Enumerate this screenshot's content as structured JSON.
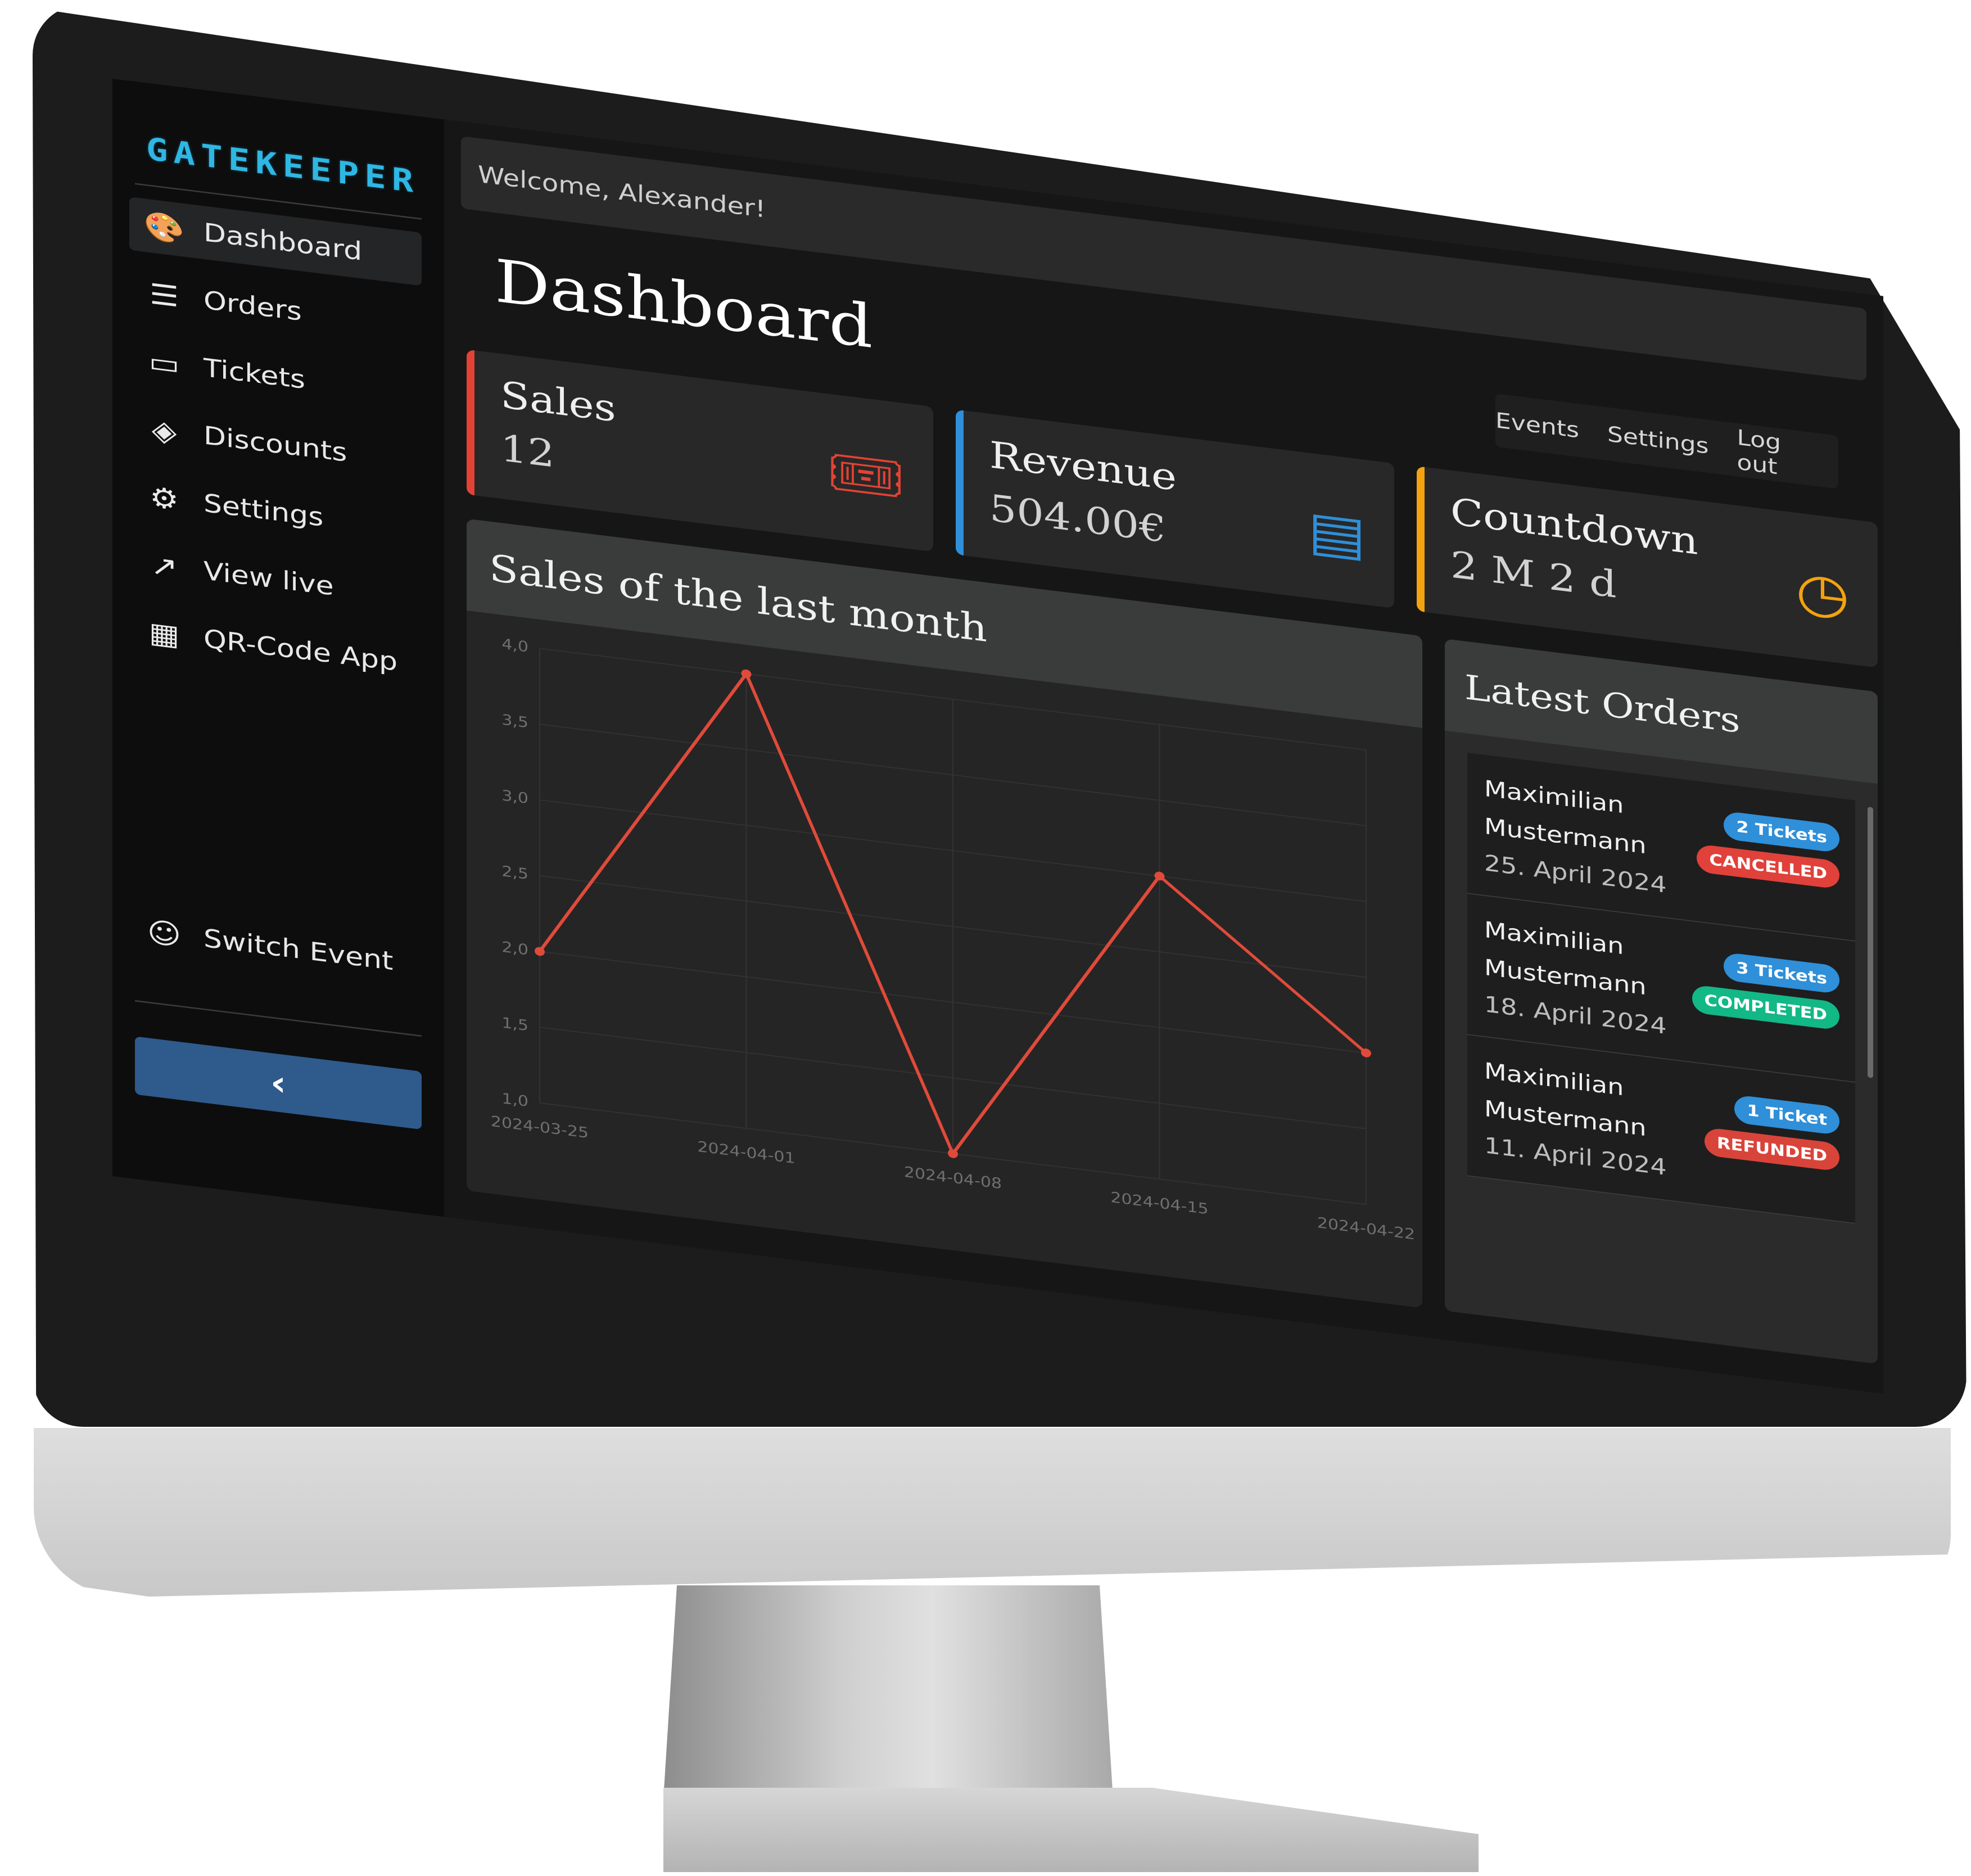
{
  "app": {
    "logo_text": "GATEKEEPER"
  },
  "sidebar": {
    "items": [
      {
        "label": "Dashboard",
        "icon": "palette-icon",
        "active": true
      },
      {
        "label": "Orders",
        "icon": "list-icon"
      },
      {
        "label": "Tickets",
        "icon": "ticket-icon"
      },
      {
        "label": "Discounts",
        "icon": "tags-icon"
      },
      {
        "label": "Settings",
        "icon": "gears-icon"
      },
      {
        "label": "View live",
        "icon": "external-link-icon"
      },
      {
        "label": "QR-Code App",
        "icon": "qr-code-icon"
      }
    ],
    "switch_event": {
      "label": "Switch Event",
      "icon": "masks-icon"
    },
    "collapse_icon": "chevron-left-icon"
  },
  "header": {
    "welcome": "Welcome, Alexander!",
    "page_title": "Dashboard",
    "links": [
      "Events",
      "Settings",
      "Log out"
    ]
  },
  "stats": [
    {
      "label": "Sales",
      "value": "12",
      "icon": "ticket-icon",
      "color": "#e34234"
    },
    {
      "label": "Revenue",
      "value": "504.00€",
      "icon": "cash-register-icon",
      "color": "#2f8fd8"
    },
    {
      "label": "Countdown",
      "value": "2 M 2 d",
      "icon": "clock-icon",
      "color": "#f2a30f"
    }
  ],
  "chart": {
    "title": "Sales of the last month"
  },
  "chart_data": {
    "type": "line",
    "title": "Sales of the last month",
    "x": [
      "2024-03-25",
      "2024-04-01",
      "2024-04-08",
      "2024-04-15",
      "2024-04-22"
    ],
    "y_ticks": [
      "1,0",
      "1,5",
      "2,0",
      "2,5",
      "3,0",
      "3,5",
      "4,0"
    ],
    "series": [
      {
        "x": [
          "2024-03-25",
          "2024-04-01",
          "2024-04-08",
          "2024-04-15",
          "2024-04-22"
        ],
        "values": [
          2,
          4,
          1,
          3,
          2
        ]
      }
    ],
    "ylim": [
      1,
      4
    ],
    "grid": true,
    "line_color": "#e04a3a"
  },
  "orders": {
    "title": "Latest Orders",
    "items": [
      {
        "name": "Maximilian Mustermann",
        "date": "25. April 2024",
        "tickets": "2 Tickets",
        "status": "CANCELLED",
        "status_color": "#e0413a"
      },
      {
        "name": "Maximilian Mustermann",
        "date": "18. April 2024",
        "tickets": "3 Tickets",
        "status": "COMPLETED",
        "status_color": "#12b886"
      },
      {
        "name": "Maximilian Mustermann",
        "date": "11. April 2024",
        "tickets": "1 Ticket",
        "status": "REFUNDED",
        "status_color": "#d9443a"
      }
    ],
    "ticket_badge_color": "#2f8fd8"
  }
}
